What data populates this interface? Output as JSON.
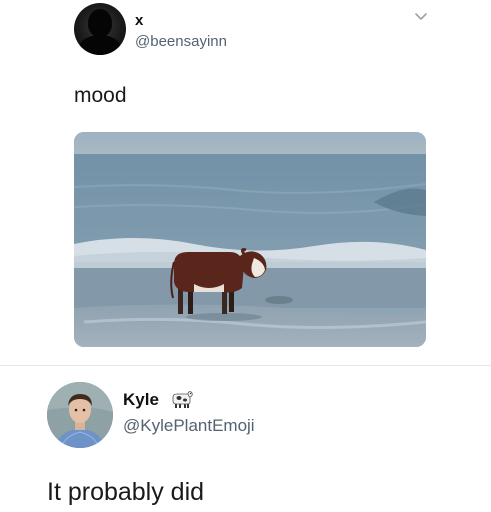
{
  "tweet": {
    "display_name": "x",
    "handle": "@beensayinn",
    "text": "mood",
    "media": "cow-standing-in-ocean-surf",
    "menu_icon": "chevron-down-icon"
  },
  "reply": {
    "display_name": "Kyle",
    "name_emoji": "cow-icon",
    "handle": "@KylePlantEmoji",
    "text": "It probably did"
  },
  "colors": {
    "text": "#111111",
    "handle": "#556270",
    "divider": "#e4e6e8"
  }
}
